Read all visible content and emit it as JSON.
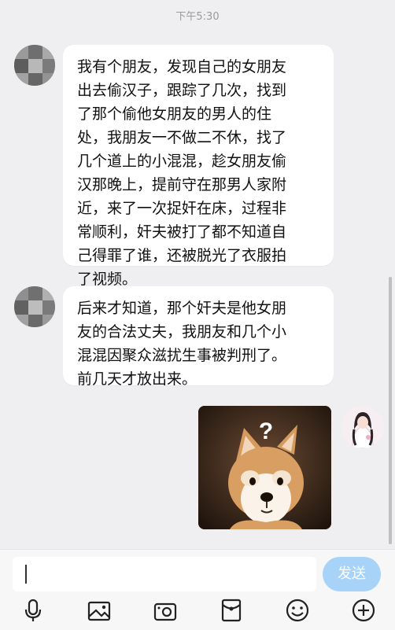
{
  "status": {
    "time": "下午5:30"
  },
  "messages": [
    {
      "sender": "friend",
      "text": "我有个朋友，发现自己的女朋友\n出去偷汉子，跟踪了几次，找到\n了那个偷他女朋友的男人的住\n处，我朋友一不做二不休，找了\n几个道上的小混混，趁女朋友偷\n汉那晚上，提前守在那男人家附\n近，来了一次捉奸在床，过程非\n常顺利，奸夫被打了都不知道自\n己得罪了谁，还被脱光了衣服拍\n了视频。"
    },
    {
      "sender": "friend",
      "text": "后来才知道，那个奸夫是他女朋\n友的合法丈夫，我朋友和几个小\n混混因聚众滋扰生事被判刑了。\n前几天才放出来。"
    },
    {
      "sender": "me",
      "type": "image",
      "image_subject": "shiba inu dog with question mark"
    }
  ],
  "meme": {
    "question_mark": "?"
  },
  "composer": {
    "input_value": "",
    "send_label": "发送"
  },
  "toolbar": {
    "icons": [
      "microphone-icon",
      "image-icon",
      "camera-icon",
      "red-packet-icon",
      "emoji-icon",
      "plus-icon"
    ]
  },
  "colors": {
    "background": "#efeff1",
    "bubble": "#ffffff",
    "send_button": "#a7d3f9"
  }
}
